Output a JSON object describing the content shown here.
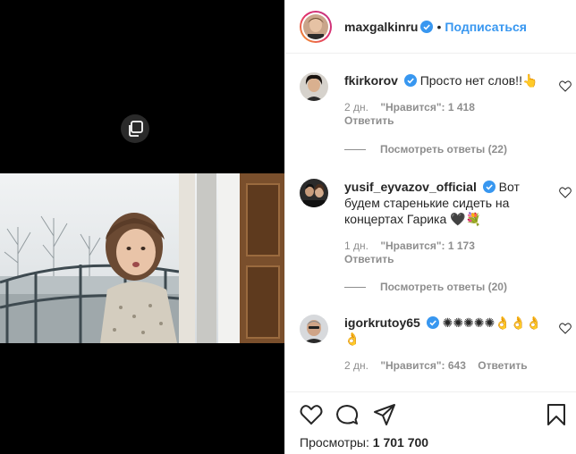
{
  "header": {
    "username": "maxgalkinru",
    "separator": "•",
    "follow_label": "Подписаться"
  },
  "comments": [
    {
      "username": "fkirkorov",
      "text": "Просто нет слов!!👆",
      "time": "2 дн.",
      "likes": "\"Нравится\": 1 418",
      "reply": "Ответить",
      "view_replies": "Посмотреть ответы (22)"
    },
    {
      "username": "yusif_eyvazov_official",
      "text": "Вот будем старенькие сидеть на концертах Гарика 🖤💐",
      "time": "1 дн.",
      "likes": "\"Нравится\": 1 173",
      "reply": "Ответить",
      "view_replies": "Посмотреть ответы (20)"
    },
    {
      "username": "igorkrutoy65",
      "text": "✺✺✺✺✺👌👌👌👌",
      "time": "2 дн.",
      "likes": "\"Нравится\": 643",
      "reply": "Ответить"
    }
  ],
  "footer": {
    "views_label": "Просмотры:",
    "views_count": "1 701 700"
  },
  "colors": {
    "accent": "#3897f0",
    "verified": "#3897f0",
    "meta_text": "#8e8e8e"
  },
  "icons": [
    "multiple-media-icon",
    "verified-icon",
    "heart-icon",
    "comment-icon",
    "share-icon",
    "save-icon"
  ]
}
